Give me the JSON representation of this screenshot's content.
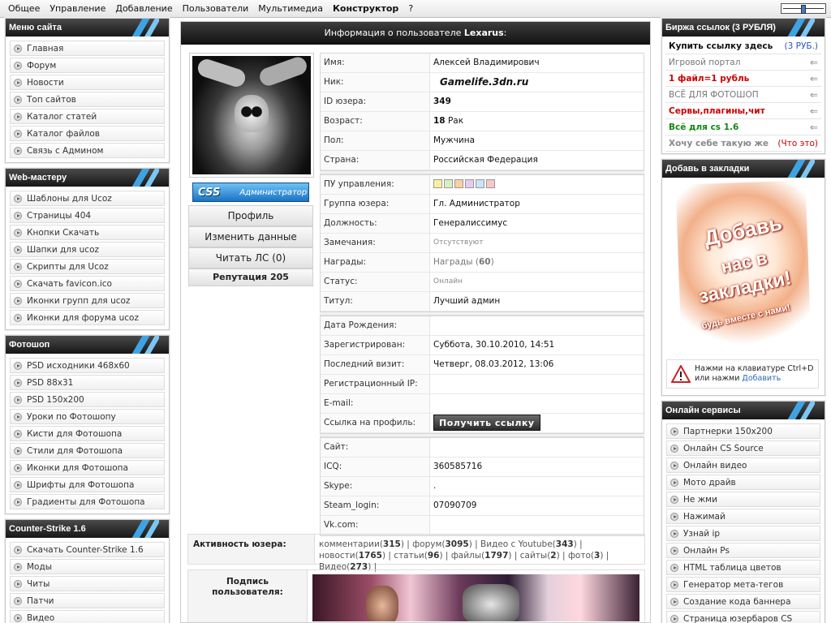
{
  "topmenu": {
    "items": [
      "Общее",
      "Управление",
      "Добавление",
      "Пользователи",
      "Мультимедиа",
      "Конструктор",
      "?"
    ]
  },
  "left": {
    "site_menu": {
      "title": "Меню сайта",
      "items": [
        "Главная",
        "Форум",
        "Новости",
        "Топ сайтов",
        "Каталог статей",
        "Каталог файлов",
        "Связь с Админом"
      ]
    },
    "webmaster": {
      "title": "Web-мастеру",
      "items": [
        "Шаблоны для Ucoz",
        "Страницы 404",
        "Кнопки Скачать",
        "Шапки для ucoz",
        "Скрипты для Ucoz",
        "Скачать favicon.ico",
        "Иконки групп для ucoz",
        "Иконки для форума ucoz"
      ]
    },
    "photoshop": {
      "title": "Фотошоп",
      "items": [
        "PSD исходники 468х60",
        "PSD 88х31",
        "PSD 150х200",
        "Уроки по Фотошопу",
        "Кисти для Фотошопа",
        "Стили для Фотошопа",
        "Иконки для Фотошопа",
        "Шрифты для Фотошопа",
        "Градиенты для Фотошопа"
      ]
    },
    "cs": {
      "title": "Counter-Strike 1.6",
      "items": [
        "Скачать Counter-Strike 1.6",
        "Моды",
        "Читы",
        "Патчи",
        "Видео"
      ]
    }
  },
  "main": {
    "header_prefix": "Информация о пользователе ",
    "header_user": "Lexarus",
    "header_suffix": ":",
    "rank_logo": "CSS",
    "rank_title": "Администратор",
    "buttons": {
      "profile": "Профиль",
      "edit": "Изменить данные",
      "pm": "Читать ЛС (0)",
      "reputation": "Репутация 205"
    },
    "labels": {
      "name": "Имя:",
      "nick": "Ник:",
      "id": "ID юзера:",
      "age": "Возраст:",
      "gender": "Пол:",
      "country": "Страна:",
      "cp": "ПУ управления:",
      "group": "Группа юзера:",
      "position": "Должность:",
      "warnings": "Замечания:",
      "awards": "Награды:",
      "status": "Статус:",
      "title": "Титул:",
      "birthday": "Дата Рождения:",
      "registered": "Зарегистрирован:",
      "lastvisit": "Последний визит:",
      "regip": "Регистрационный IP:",
      "email": "E-mail:",
      "link": "Ссылка на профиль:",
      "site": "Сайт:",
      "icq": "ICQ:",
      "skype": "Skype:",
      "steam": "Steam_login:",
      "vk": "Vk.com:"
    },
    "values": {
      "name": "Алексей Владимирович",
      "nick": "Gamelife.3dn.ru",
      "id": "349",
      "age_num": "18",
      "age_sign": "Рак",
      "gender": "Мужчина",
      "country": "Российская Федерация",
      "group": "Гл. Администратор",
      "position": "Генералиссимус",
      "warnings": "Отсутствуют",
      "awards_text": "Награды (",
      "awards_num": "60",
      "awards_close": ")",
      "status": "Онлайн",
      "title": "Лучший админ",
      "registered": "Суббота, 30.10.2010, 14:51",
      "lastvisit": "Четверг, 08.03.2012, 13:06",
      "getlink": "Получить ссылку",
      "icq": "360585716",
      "skype": ".",
      "steam": "07090709"
    },
    "activity_label": "Активность юзера:",
    "activity": [
      {
        "label": "комментарии",
        "count": "315"
      },
      {
        "label": "форум",
        "count": "3095"
      },
      {
        "label": "Видео с Youtube",
        "count": "343"
      },
      {
        "label": "новости",
        "count": "1765"
      },
      {
        "label": "статьи",
        "count": "96"
      },
      {
        "label": "файлы",
        "count": "1797"
      },
      {
        "label": "сайты",
        "count": "2"
      },
      {
        "label": "фото",
        "count": "3"
      },
      {
        "label": "Видео",
        "count": "273"
      }
    ],
    "signature_label_1": "Подпись",
    "signature_label_2": "пользователя:"
  },
  "right": {
    "exchange": {
      "title": "Биржа ссылок (3 РУБЛЯ)",
      "buy": "Купить ссылку здесь",
      "price": "(3 РУБ.)",
      "links": [
        {
          "text": "Игровой портал",
          "color": "#777777",
          "bold": false
        },
        {
          "text": "1 файл=1 рубль",
          "color": "#cc0000",
          "bold": true
        },
        {
          "text": "ВСЁ ДЛЯ ФОТОШОП",
          "color": "#777777",
          "bold": false
        },
        {
          "text": "Сервы,плагины,чит",
          "color": "#cc0000",
          "bold": true
        },
        {
          "text": "Всё для cs 1.6",
          "color": "#118811",
          "bold": true
        }
      ],
      "want": "Хочу себе такую же",
      "what": "(Что это)"
    },
    "bookmark": {
      "title": "Добавь в закладки",
      "img_line1": "Добавь",
      "img_line2": "нас в",
      "img_line3": "закладки!",
      "img_line4": "будь вместе с нами!",
      "hint1": "Нажми на клавиатуре Ctrl+D",
      "hint2": "или нажми ",
      "hint_link": "Добавить"
    },
    "online": {
      "title": "Онлайн сервисы",
      "items": [
        "Партнерки 150х200",
        "Онлайн CS Source",
        "Онлайн видео",
        "Мото драйв",
        "Не жми",
        "Нажимай",
        "Узнай ip",
        "Онлайн Ps",
        "HTML таблица цветов",
        "Генератор мета-тегов",
        "Создание кода баннера",
        "Страница юзербаров CS"
      ]
    }
  }
}
